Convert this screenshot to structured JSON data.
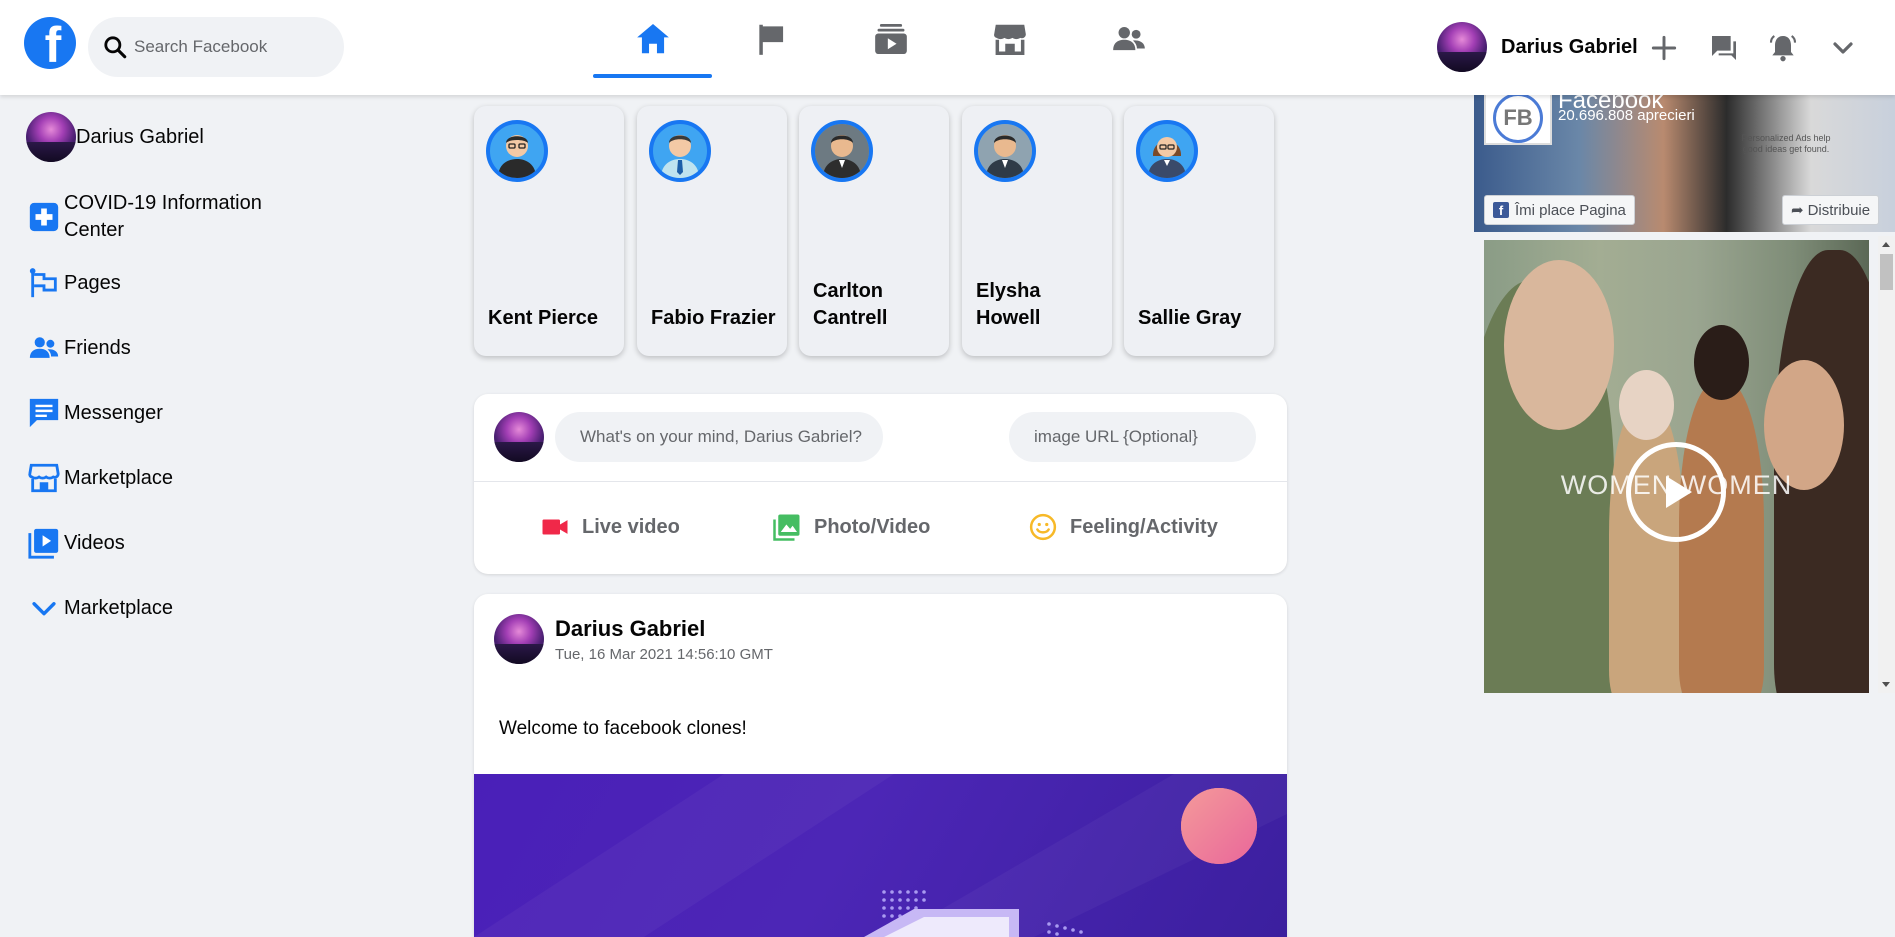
{
  "header": {
    "search_placeholder": "Search Facebook",
    "nav_tabs": [
      "home-icon",
      "flag-icon",
      "watch-icon",
      "marketplace-icon",
      "groups-icon"
    ],
    "active_tab": "home",
    "user_name": "Darius Gabriel",
    "right_icons": [
      "plus-icon",
      "messenger-icon",
      "bell-icon",
      "chevron-down-icon"
    ]
  },
  "sidebar": {
    "profile_name": "Darius Gabriel",
    "items": [
      {
        "label": "COVID-19 Information Center",
        "icon": "covid-icon"
      },
      {
        "label": "Pages",
        "icon": "flag-icon"
      },
      {
        "label": "Friends",
        "icon": "friends-icon"
      },
      {
        "label": "Messenger",
        "icon": "messenger-icon"
      },
      {
        "label": "Marketplace",
        "icon": "marketplace-icon"
      },
      {
        "label": "Videos",
        "icon": "video-icon"
      },
      {
        "label": "Marketplace",
        "icon": "chevron-down-icon"
      }
    ]
  },
  "stories": [
    {
      "name": "Kent Pierce"
    },
    {
      "name": "Fabio Frazier"
    },
    {
      "name": "Carlton Cantrell"
    },
    {
      "name": "Elysha Howell"
    },
    {
      "name": "Sallie Gray"
    }
  ],
  "composer": {
    "placeholder": "What's on your mind, Darius Gabriel?",
    "url_placeholder": "image URL {Optional}",
    "actions": [
      "Live video",
      "Photo/Video",
      "Feeling/Activity"
    ]
  },
  "post": {
    "author": "Darius Gabriel",
    "timestamp": "Tue, 16 Mar 2021 14:56:10 GMT",
    "text": "Welcome to facebook clones!"
  },
  "ad_page": {
    "logo_text": "FB",
    "title": "Facebook",
    "likes": "20.696.808 aprecieri",
    "like_button": "Îmi place Pagina",
    "share_button": "Distribuie",
    "ads_note": "Personalized Ads help good ideas get found."
  },
  "video": {
    "caption": "WOMEN WOMEN"
  },
  "colors": {
    "brand_blue": "#1877f2",
    "background": "#f0f2f5",
    "live_red": "#f02849",
    "photo_green": "#45bd62",
    "feeling_yellow": "#f7b928"
  }
}
